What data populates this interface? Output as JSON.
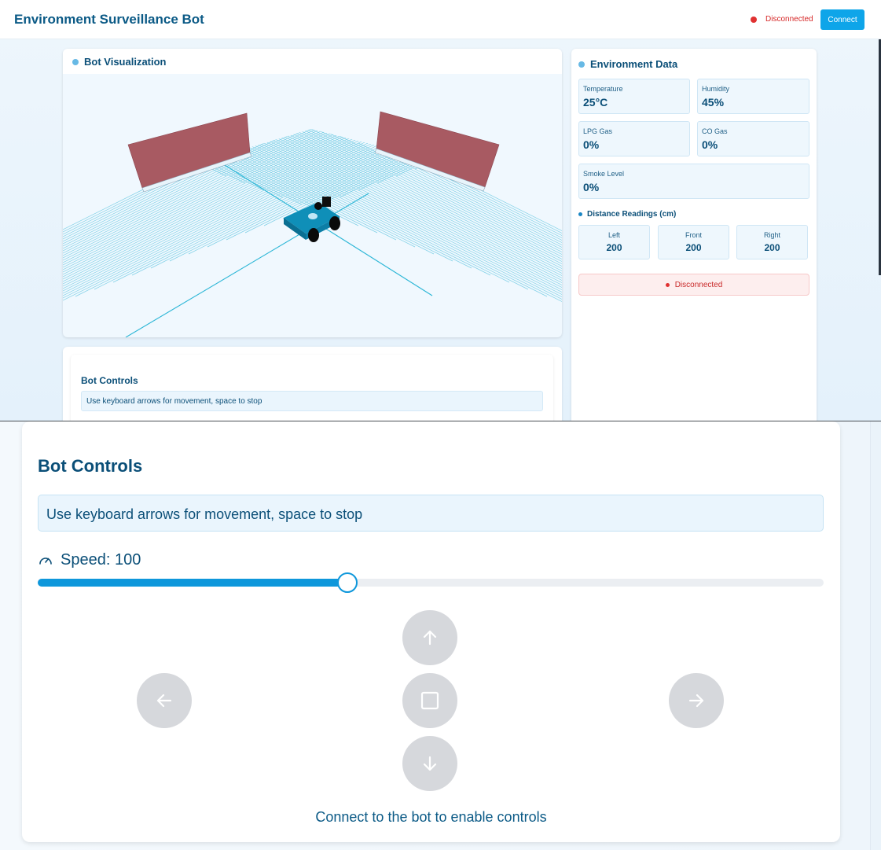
{
  "header": {
    "title": "Environment Surveillance Bot",
    "status": "Disconnected",
    "connect_label": "Connect"
  },
  "visualization": {
    "title": "Bot Visualization"
  },
  "environment": {
    "title": "Environment Data",
    "sensors": [
      {
        "label": "Temperature",
        "value": "25°C"
      },
      {
        "label": "Humidity",
        "value": "45%"
      },
      {
        "label": "LPG Gas",
        "value": "0%"
      },
      {
        "label": "CO Gas",
        "value": "0%"
      },
      {
        "label": "Smoke Level",
        "value": "0%"
      }
    ],
    "distance": {
      "title": "Distance Readings (cm)",
      "items": [
        {
          "label": "Left",
          "value": "200"
        },
        {
          "label": "Front",
          "value": "200"
        },
        {
          "label": "Right",
          "value": "200"
        }
      ]
    },
    "status": "Disconnected"
  },
  "controls": {
    "title": "Bot Controls",
    "hint": "Use keyboard arrows for movement, space to stop",
    "speed_label": "Speed: 100",
    "speed_fraction": 0.394,
    "footer": "Connect to the bot to enable controls",
    "icons": [
      "gauge-icon",
      "arrow-up-icon",
      "arrow-left-icon",
      "stop-icon",
      "arrow-right-icon",
      "arrow-down-icon"
    ]
  },
  "colors": {
    "primary": "#0ea5e9",
    "title_text": "#0b4f78",
    "disconnected": "#e03131",
    "wall": "#a85a62",
    "bot_body": "#0f8fb8",
    "grid": "#6ccbe3",
    "button_disabled": "#d6d8dc"
  }
}
